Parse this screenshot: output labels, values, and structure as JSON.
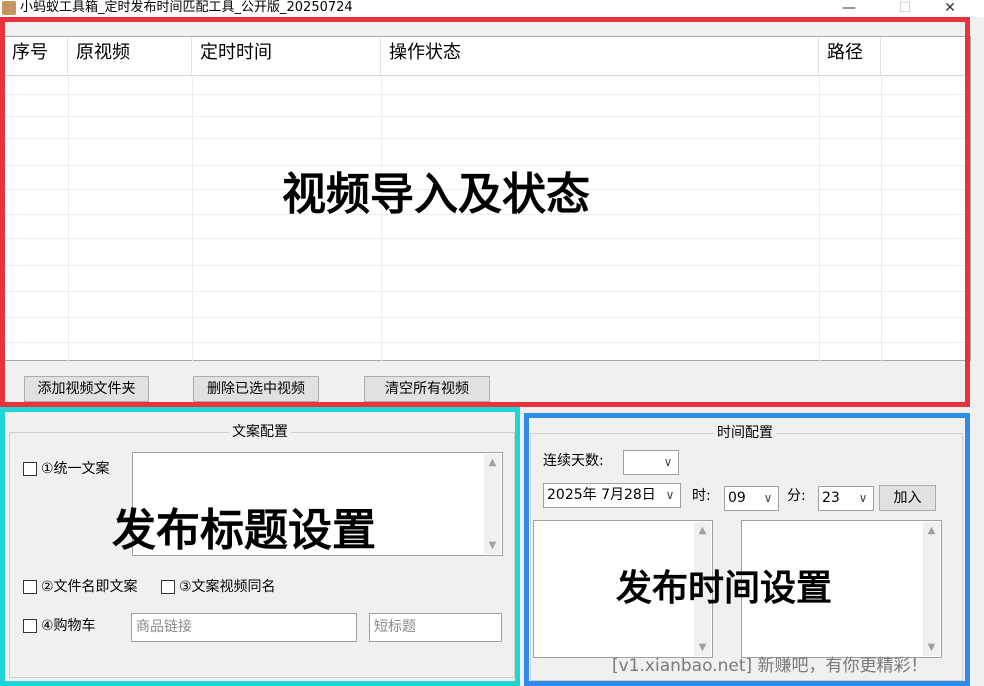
{
  "window": {
    "title": "小蚂蚁工具箱_定时发布时间匹配工具_公开版_20250724",
    "minimize_glyph": "—",
    "maximize_glyph": "☐",
    "close_glyph": "✕",
    "app_icon": "app-logo-icon"
  },
  "table": {
    "columns": [
      "序号",
      "原视频",
      "定时时间",
      "操作状态",
      "路径"
    ],
    "rows": []
  },
  "table_buttons": {
    "add_folder": "添加视频文件夹",
    "delete_selected": "删除已选中视频",
    "clear_all": "清空所有视频"
  },
  "copy_config": {
    "title": "文案配置",
    "unified_copy_label": "①统一文案",
    "unified_copy_value": "",
    "filename_copy_label": "②文件名即文案",
    "same_name_label": "③文案视频同名",
    "cart_label": "④购物车",
    "product_link_placeholder": "商品链接",
    "short_title_placeholder": "短标题"
  },
  "time_config": {
    "title": "时间配置",
    "days_label": "连续天数:",
    "days_value": "",
    "date_value": "2025年 7月28日",
    "hour_label": "时:",
    "hour_value": "09",
    "minute_label": "分:",
    "minute_value": "23",
    "add_button": "加入"
  },
  "annotations": {
    "import_status": "视频导入及状态",
    "title_settings": "发布标题设置",
    "time_settings": "发布时间设置",
    "colors": {
      "red": "#e8323c",
      "cyan": "#1fd6d6",
      "blue": "#2f8be8"
    }
  },
  "watermark": "[v1.xianbao.net] 新赚吧，有你更精彩！"
}
